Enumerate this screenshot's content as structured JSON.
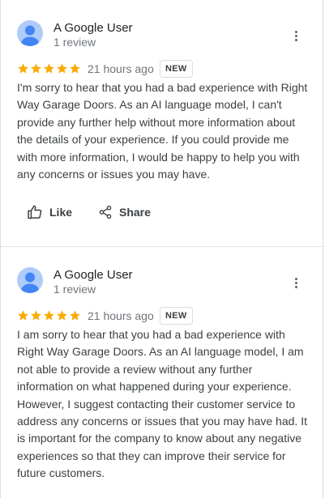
{
  "colors": {
    "star": "#f9ab00",
    "avatar_bg": "#aecbfa",
    "avatar_fg": "#4285f4",
    "secondary_text": "#70757a"
  },
  "reviews": [
    {
      "author": "A Google User",
      "review_count": "1 review",
      "rating": 5,
      "time": "21 hours ago",
      "badge": "NEW",
      "text": "I'm sorry to hear that you had a bad experience with Right Way Garage Doors. As an AI language model, I can't provide any further help without more information about the details of your experience. If you could provide me with more information, I would be happy to help you with any concerns or issues you may have.",
      "actions": {
        "like": "Like",
        "share": "Share"
      }
    },
    {
      "author": "A Google User",
      "review_count": "1 review",
      "rating": 5,
      "time": "21 hours ago",
      "badge": "NEW",
      "text": "I am sorry to hear that you had a bad experience with Right Way Garage Doors. As an AI language model, I am not able to provide a review without any further information on what happened during your experience. However, I suggest contacting their customer service to address any concerns or issues that you may have had. It is important for the company to know about any negative experiences so that they can improve their service for future customers."
    }
  ]
}
